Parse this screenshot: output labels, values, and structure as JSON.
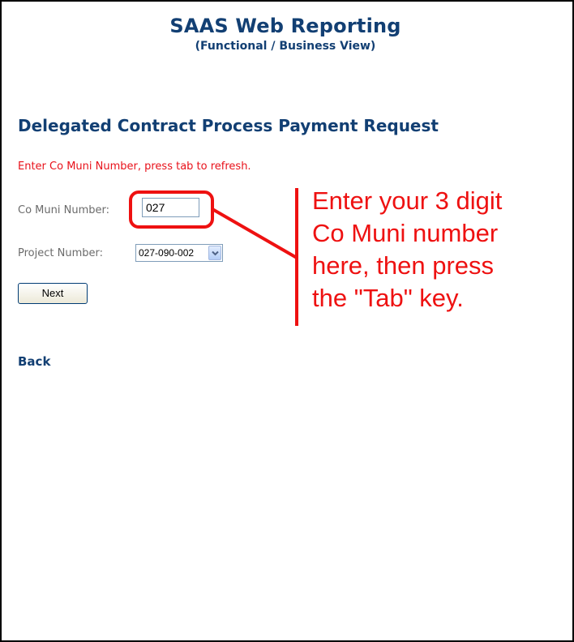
{
  "header": {
    "app_title": "SAAS Web Reporting",
    "app_subtitle": "(Functional / Business View)"
  },
  "page": {
    "title": "Delegated Contract Process Payment Request",
    "instruction": "Enter Co Muni Number, press tab to refresh."
  },
  "form": {
    "co_muni_label": "Co Muni Number:",
    "co_muni_value": "027",
    "project_label": "Project Number:",
    "project_selected": "027-090-002",
    "next_label": "Next"
  },
  "nav": {
    "back_label": "Back"
  },
  "annotation": {
    "text": "Enter your 3 digit\nCo Muni number\nhere, then press\nthe \"Tab\" key.",
    "color": "#ee1111"
  },
  "colors": {
    "title_blue": "#123f73",
    "instruction_red": "#e8111a",
    "label_gray": "#6b6b6b"
  },
  "icons": {
    "dropdown": "chevron-down-icon"
  }
}
